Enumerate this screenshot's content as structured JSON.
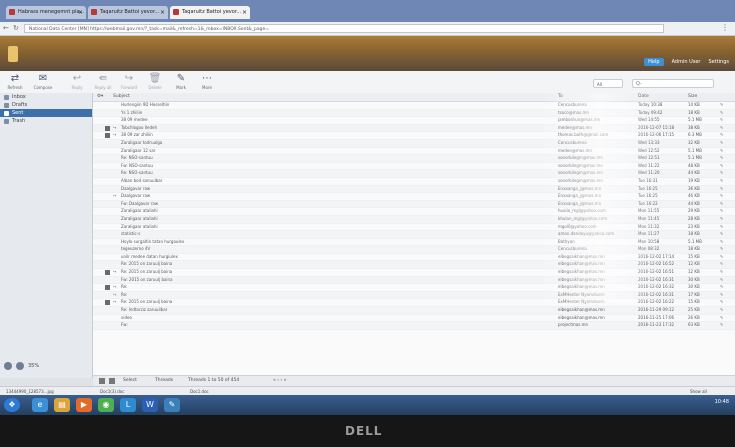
{
  "browser": {
    "tabs": [
      {
        "label": "Habrass menegemnt pla..."
      },
      {
        "label": "Taqaruitz Battoi yevor..."
      },
      {
        "label": "Taqaruitz Battoi yevor..."
      }
    ],
    "url_lock": "National Data Center [MN]",
    "url": "https://webmail.gov.mn/?_task=mail&_refresh=1&_mbox=INBOX.Sent&_page="
  },
  "header": {
    "links": [
      "Help",
      "Admin User",
      "Settings"
    ]
  },
  "toolbar": {
    "buttons": [
      {
        "label": "Refresh",
        "icon": "refresh-icon"
      },
      {
        "label": "Compose",
        "icon": "compose-icon"
      },
      {
        "label": "Reply",
        "icon": "reply-icon"
      },
      {
        "label": "Reply all",
        "icon": "reply-all-icon"
      },
      {
        "label": "Forward",
        "icon": "forward-icon"
      },
      {
        "label": "Delete",
        "icon": "delete-icon"
      },
      {
        "label": "Mark",
        "icon": "mark-icon"
      },
      {
        "label": "More",
        "icon": "more-icon"
      }
    ],
    "quick_filter": "All",
    "search_placeholder": "Q-"
  },
  "folders": {
    "items": [
      {
        "label": "Inbox",
        "selected": false
      },
      {
        "label": "Drafts",
        "selected": false
      },
      {
        "label": "Sent",
        "selected": true
      },
      {
        "label": "Trash",
        "selected": false
      }
    ],
    "quota": "35%"
  },
  "list": {
    "columns": {
      "subject": "Subject",
      "from": "To",
      "date": "Date",
      "size": "Size"
    },
    "rows": [
      {
        "subject": "Hurlengiin 9D Hesseltiin",
        "from": "Cencusburena",
        "date": "Today 10:38",
        "size": "14 KB"
      },
      {
        "subject": "Ys 1 zhiliin",
        "from": "tsoco@mas.mn",
        "date": "Today 09:42",
        "size": "18 KB"
      },
      {
        "subject": "38 09 medee",
        "from": "jamboshun@mas.mn",
        "date": "Wed 14:55",
        "size": "5.1 MB"
      },
      {
        "subject": "Tobchlogoo Iledeh",
        "from": "medee@mas.mn",
        "date": "2016-12-07 15:18",
        "size": "38 KB"
      },
      {
        "subject": "38 09 zar zhiliin",
        "from": "thomas.bath@gmail.com",
        "date": "2016-12-06 17:15",
        "size": "6.3 MB"
      },
      {
        "subject": "Zaraligaar todruulga",
        "from": "Cencusburena",
        "date": "Wed 13:33",
        "size": "32 KB"
      },
      {
        "subject": "Zaraligaar 12 sar",
        "from": "medee@mas.mn",
        "date": "Wed 12:52",
        "size": "5.1 MB"
      },
      {
        "subject": "Re: NSO-santuu",
        "from": "sonorbilegm@mas.mn",
        "date": "Wed 12:51",
        "size": "5.1 MB"
      },
      {
        "subject": "Fw: NSO-santuu",
        "from": "sonorbilegm@mas.mn",
        "date": "Wed 11:22",
        "size": "48 KB"
      },
      {
        "subject": "Re: NSO-santuu",
        "from": "sonorbilegm@mas.mn",
        "date": "Wed 11:20",
        "size": "44 KB"
      },
      {
        "subject": "Alban bod sanuulbar",
        "from": "sonorbilegm@mas.mn",
        "date": "Tue 16:31",
        "size": "19 KB"
      },
      {
        "subject": "Daalgavar raw",
        "from": "Enxaanga_j@mas.mn",
        "date": "Tue 16:25",
        "size": "36 KB"
      },
      {
        "subject": "Daalgavar raw",
        "from": "Enxaanga_j@mas.mn",
        "date": "Tue 16:25",
        "size": "46 KB"
      },
      {
        "subject": "Fw: Daalgavar raw",
        "from": "Enxaanga_j@mas.mn",
        "date": "Tue 16:22",
        "size": "44 KB"
      },
      {
        "subject": "Zaraligaar ataliahi",
        "from": "huaiio_mgl@yahoo.com",
        "date": "Mon 11:55",
        "size": "29 KB"
      },
      {
        "subject": "Zaraligaar ataliahi",
        "from": "khulan_mgl@yahoo.com",
        "date": "Mon 11:45",
        "size": "28 KB"
      },
      {
        "subject": "Zaraligaar ataliahi",
        "from": "mgol0@yahoo.com",
        "date": "Mon 11:32",
        "size": "23 KB"
      },
      {
        "subject": "statistic-s",
        "from": "aman.dandayu@yahoo.com",
        "date": "Mon 11:27",
        "size": "18 KB"
      },
      {
        "subject": "Hoylo surgaltin tatan hurgoulex",
        "from": "Bathyan",
        "date": "Mon 10:58",
        "size": "5.1 MB"
      },
      {
        "subject": "tegeuzerno 4V",
        "from": "Cencusburena",
        "date": "Mon 08:32",
        "size": "18 KB"
      },
      {
        "subject": "unilr medee datan hurgiulex",
        "from": "elbegsaikhan@mas.mn",
        "date": "2016-12-02 17:14",
        "size": "15 KB"
      },
      {
        "subject": "Re: 2015 on zaruulj baina",
        "from": "elbegsaikhan@mas.mn",
        "date": "2016-12-02 16:52",
        "size": "12 KB"
      },
      {
        "subject": "Re: 2015 on zaruulj baina",
        "from": "elbegsaikhan@mas.mn",
        "date": "2016-12-02 16:51",
        "size": "12 KB"
      },
      {
        "subject": "Fw: 2015 on zaruulj baina",
        "from": "elbegsaikhan@mas.mn",
        "date": "2016-12-02 16:31",
        "size": "30 KB"
      },
      {
        "subject": "Re:",
        "from": "elbegsaikhan@mas.mn",
        "date": "2016-12-02 16:32",
        "size": "30 KB"
      },
      {
        "subject": "Re:",
        "from": "ExMHenter Nyamdoorn",
        "date": "2016-12-02 16:31",
        "size": "17 KB"
      },
      {
        "subject": "Re: 2015 on zaruulj baina",
        "from": "ExMHenter Nyamdoorn",
        "date": "2016-12-02 16:22",
        "size": "15 KB"
      },
      {
        "subject": "Re: Indtorziz zaruuilbar",
        "from": "elbegsaikhan@mas.mn",
        "date": "2016-11-29 09:12",
        "size": "25 KB"
      },
      {
        "subject": "video",
        "from": "elbegsaikhan@mas.mn",
        "date": "2016-11-25 17:06",
        "size": "26 KB"
      },
      {
        "subject": "Fw:",
        "from": "projectmas.mn",
        "date": "2016-11-23 17:32",
        "size": "63 KB"
      }
    ],
    "footer": {
      "select": "Select",
      "threads": "Threads",
      "count": "Threads 1 to 50 of 454"
    }
  },
  "downloads": [
    {
      "label": "13444990_128573...jpg"
    },
    {
      "label": "Doc1(3).doc"
    },
    {
      "label": "Doc1.doc"
    }
  ],
  "downloads_show_all": "Show all",
  "taskbar": {
    "apps": [
      "start-orb",
      "ie-icon",
      "explorer-icon",
      "media-icon",
      "chrome-icon",
      "lync-icon",
      "word-icon",
      "paint-icon"
    ],
    "time": "10:48"
  },
  "bezel_brand": "DELL"
}
